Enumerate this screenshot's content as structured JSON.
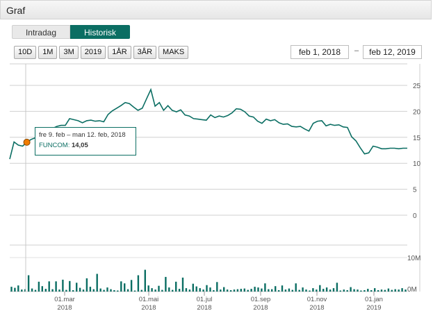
{
  "header": {
    "title": "Graf"
  },
  "tabs": {
    "intradag": "Intradag",
    "historisk": "Historisk"
  },
  "ranges": [
    "10D",
    "1M",
    "3M",
    "2019",
    "1ÅR",
    "3ÅR",
    "MAKS"
  ],
  "dates": {
    "from": "feb 1, 2018",
    "separator": "–",
    "to": "feb 12, 2019"
  },
  "tooltip": {
    "period": "fre 9. feb – man 12. feb, 2018",
    "series": "FUNCOM:",
    "value": "14,05"
  },
  "colors": {
    "accent": "#0b6e63",
    "marker": "#f07c00"
  },
  "chart_data": {
    "type": "line",
    "series": [
      {
        "values": [
          10.8,
          14.1,
          13.5,
          13.3,
          14.05,
          14.6,
          14.9,
          15.4,
          15.6,
          16.2,
          16.7,
          17.1,
          17.3,
          17.3,
          18.6,
          18.4,
          18.2,
          17.8,
          18.2,
          18.3,
          18.1,
          18.2,
          18.0,
          19.4,
          20.1,
          20.6,
          21.1,
          21.7,
          21.5,
          20.8,
          20.2,
          20.6,
          22.4,
          24.2,
          21.0,
          21.7,
          20.2,
          21.1,
          20.2,
          19.9,
          20.3,
          19.3,
          19.1,
          18.6,
          18.5,
          18.4,
          18.3,
          19.3,
          18.8,
          19.1,
          18.9,
          19.2,
          19.7,
          20.5,
          20.4,
          19.9,
          19.1,
          18.9,
          18.1,
          17.7,
          18.5,
          18.2,
          18.4,
          17.8,
          17.5,
          17.6,
          17.1,
          17.0,
          17.1,
          16.6,
          16.2,
          17.7,
          18.1,
          18.2,
          17.2,
          17.5,
          17.3,
          17.4,
          17.0,
          16.9,
          15.1,
          14.3,
          13.0,
          11.8,
          12.0,
          13.3,
          13.1,
          12.8,
          12.8,
          12.9,
          12.9,
          12.8,
          12.9,
          12.9
        ]
      }
    ],
    "x_tick_labels": [
      {
        "month": "01.mar",
        "year": "2018"
      },
      {
        "month": "01.mai",
        "year": "2018"
      },
      {
        "month": "01.jul",
        "year": "2018"
      },
      {
        "month": "01.sep",
        "year": "2018"
      },
      {
        "month": "01.nov",
        "year": "2018"
      },
      {
        "month": "01.jan",
        "year": "2019"
      }
    ],
    "y_ticks": [
      "25",
      "20",
      "15",
      "10",
      "5",
      "0"
    ],
    "ylim": [
      0,
      25
    ],
    "volume": {
      "y_ticks": [
        "10M",
        "0M"
      ],
      "ylim_millions": [
        0,
        10
      ],
      "values_millions": [
        1.4,
        1.1,
        1.8,
        0.6,
        0.7,
        4.8,
        0.9,
        0.5,
        2.9,
        1.6,
        0.8,
        3.0,
        0.7,
        3.0,
        0.6,
        3.5,
        0.5,
        3.1,
        0.4,
        2.6,
        1.1,
        0.6,
        3.9,
        1.4,
        0.7,
        5.2,
        0.9,
        0.5,
        1.2,
        0.7,
        0.4,
        0.3,
        3.0,
        2.4,
        0.7,
        3.4,
        0.3,
        4.8,
        0.5,
        6.4,
        1.8,
        1.0,
        0.6,
        1.7,
        0.5,
        4.3,
        1.2,
        0.5,
        2.9,
        0.8,
        4.1,
        1.0,
        0.6,
        2.3,
        1.5,
        1.0,
        0.6,
        1.9,
        1.2,
        0.4,
        2.8,
        0.6,
        1.3,
        0.6,
        0.4,
        0.6,
        0.7,
        0.8,
        0.9,
        0.5,
        0.8,
        1.4,
        1.2,
        0.9,
        2.4,
        0.7,
        0.7,
        1.6,
        0.4,
        1.8,
        0.6,
        0.9,
        0.5,
        2.4,
        0.5,
        1.2,
        0.6,
        0.3,
        1.0,
        0.6,
        1.9,
        0.8,
        1.2,
        0.6,
        1.0,
        2.6,
        0.3,
        0.6,
        0.4,
        1.3,
        0.7,
        0.6,
        0.3,
        0.4,
        0.8,
        0.4,
        1.0,
        0.4,
        0.6,
        0.5,
        0.9,
        0.5,
        0.7,
        0.6,
        1.0,
        0.6
      ]
    },
    "hover_point": {
      "index": 4,
      "value": 14.05
    }
  }
}
